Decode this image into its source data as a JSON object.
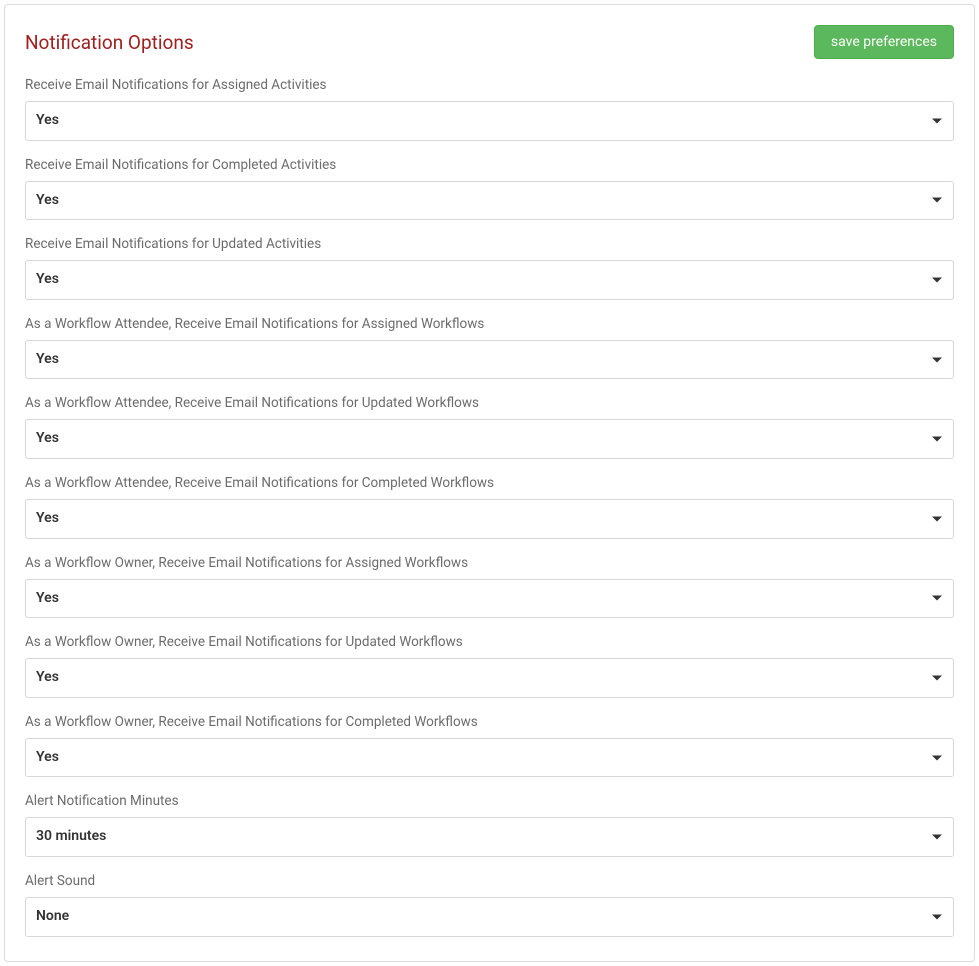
{
  "header": {
    "title": "Notification Options",
    "save_button": "save preferences"
  },
  "fields": [
    {
      "label": "Receive Email Notifications for Assigned Activities",
      "value": "Yes"
    },
    {
      "label": "Receive Email Notifications for Completed Activities",
      "value": "Yes"
    },
    {
      "label": "Receive Email Notifications for Updated Activities",
      "value": "Yes"
    },
    {
      "label": "As a Workflow Attendee, Receive Email Notifications for Assigned Workflows",
      "value": "Yes"
    },
    {
      "label": "As a Workflow Attendee, Receive Email Notifications for Updated Workflows",
      "value": "Yes"
    },
    {
      "label": "As a Workflow Attendee, Receive Email Notifications for Completed Workflows",
      "value": "Yes"
    },
    {
      "label": "As a Workflow Owner, Receive Email Notifications for Assigned Workflows",
      "value": "Yes"
    },
    {
      "label": "As a Workflow Owner, Receive Email Notifications for Updated Workflows",
      "value": "Yes"
    },
    {
      "label": "As a Workflow Owner, Receive Email Notifications for Completed Workflows",
      "value": "Yes"
    },
    {
      "label": "Alert Notification Minutes",
      "value": "30 minutes"
    },
    {
      "label": "Alert Sound",
      "value": "None"
    }
  ]
}
